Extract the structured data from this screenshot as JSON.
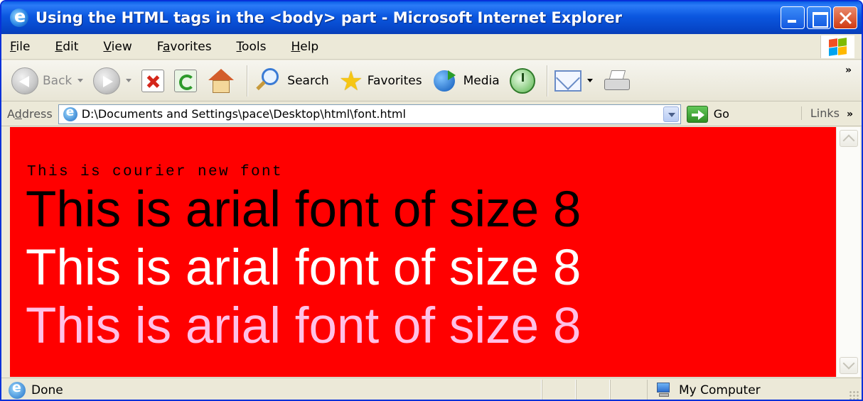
{
  "window": {
    "title": "Using the HTML tags in the <body> part - Microsoft Internet Explorer"
  },
  "menu": {
    "items": [
      {
        "underline": "F",
        "rest": "ile"
      },
      {
        "underline": "E",
        "rest": "dit"
      },
      {
        "underline": "V",
        "rest": "iew"
      },
      {
        "pre": "F",
        "underline": "a",
        "rest": "vorites"
      },
      {
        "underline": "T",
        "rest": "ools"
      },
      {
        "underline": "H",
        "rest": "elp"
      }
    ]
  },
  "toolbar": {
    "back_label": "Back",
    "search_label": "Search",
    "favorites_label": "Favorites",
    "media_label": "Media",
    "more": "»"
  },
  "address": {
    "label_pre": "A",
    "label_ul": "d",
    "label_rest": "dress",
    "url": "D:\\Documents and Settings\\pace\\Desktop\\html\\font.html",
    "go_label": "Go",
    "links_label": "Links",
    "links_more": "»"
  },
  "content": {
    "background": "#ff0000",
    "courier_text": "This is courier new font",
    "arial_lines": [
      {
        "text": "This is arial font of size 8",
        "color": "#000000"
      },
      {
        "text": "This is arial font of size 8",
        "color": "#ffffff"
      },
      {
        "text": "This is arial font of size 8",
        "color": "#ffc0e6"
      }
    ]
  },
  "status": {
    "text": "Done",
    "zone": "My Computer"
  }
}
